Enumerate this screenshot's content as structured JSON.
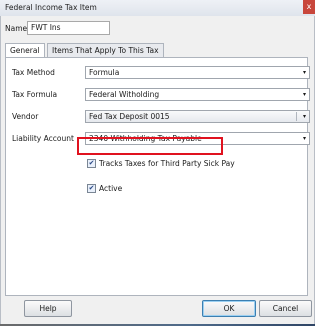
{
  "window": {
    "title": "Federal Income Tax Item",
    "close_symbol": "x"
  },
  "header": {
    "name_label": "Name",
    "name_value": "FWT Ins"
  },
  "tabs": [
    {
      "label": "General",
      "active": true
    },
    {
      "label": "Items That Apply To This Tax",
      "active": false
    }
  ],
  "fields": {
    "tax_method": {
      "label": "Tax Method",
      "value": "Formula"
    },
    "tax_formula": {
      "label": "Tax Formula",
      "value": "Federal Witholding"
    },
    "vendor": {
      "label": "Vendor",
      "value": "Fed Tax Deposit 0015"
    },
    "liability_account": {
      "label": "Liability Account",
      "value": "2340 Withholding Tax Payable"
    }
  },
  "checkboxes": {
    "third_party": {
      "label": "Tracks Taxes for Third Party Sick Pay",
      "checked": true
    },
    "active": {
      "label": "Active",
      "checked": true
    }
  },
  "buttons": {
    "help": "Help",
    "ok": "OK",
    "cancel": "Cancel"
  },
  "icons": {
    "dropdown": "▾",
    "checkmark": "✔"
  },
  "colors": {
    "highlight_border": "#e0121f",
    "close_button": "#c8463b"
  }
}
